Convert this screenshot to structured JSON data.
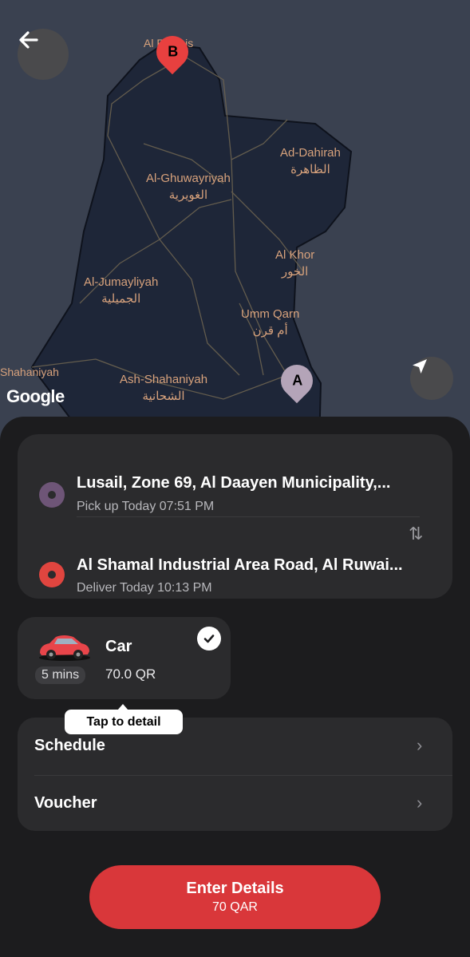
{
  "map": {
    "places": [
      {
        "en": "Ad-Dahirah",
        "ar": "الظاهرة"
      },
      {
        "en": "Al-Ghuwayriyah",
        "ar": "الغويرية"
      },
      {
        "en": "Al Khor",
        "ar": "الخور"
      },
      {
        "en": "Al-Jumayliyah",
        "ar": "الجميلية"
      },
      {
        "en": "Umm Qarn",
        "ar": "أم قرن"
      },
      {
        "en": "Ash-Shahaniyah",
        "ar": "الشحانية"
      },
      {
        "en": "Al Ruwais",
        "ar": ""
      },
      {
        "en": "Shahaniyah",
        "ar": ""
      }
    ],
    "pin_a": "A",
    "pin_b": "B",
    "attribution": "Google",
    "colors": {
      "land": "#1e2638",
      "water": "#3a4150",
      "road": "#6b6250",
      "pin_a": "#b4a4b8",
      "pin_b": "#e8403f"
    }
  },
  "route": {
    "pickup": {
      "title": "Lusail, Zone 69, Al Daayen Municipality,...",
      "subtitle": "Pick up Today 07:51 PM",
      "color": "#6e5577"
    },
    "dropoff": {
      "title": "Al Shamal Industrial Area Road, Al Ruwai...",
      "subtitle": "Deliver Today 10:13 PM",
      "color": "#e0453f"
    }
  },
  "vehicle": {
    "name": "Car",
    "price": "70.0 QR",
    "eta": "5 mins",
    "selected": true
  },
  "tooltip": "Tap to detail",
  "options": [
    {
      "label": "Schedule"
    },
    {
      "label": "Voucher"
    }
  ],
  "cta": {
    "label": "Enter Details",
    "amount": "70 QAR",
    "color": "#d9373a"
  },
  "icons": {
    "back": "arrow-left-icon",
    "locate": "navigation-arrow-icon",
    "swap": "swap-vertical-icon",
    "chevron": "chevron-right-icon",
    "check": "check-icon"
  }
}
